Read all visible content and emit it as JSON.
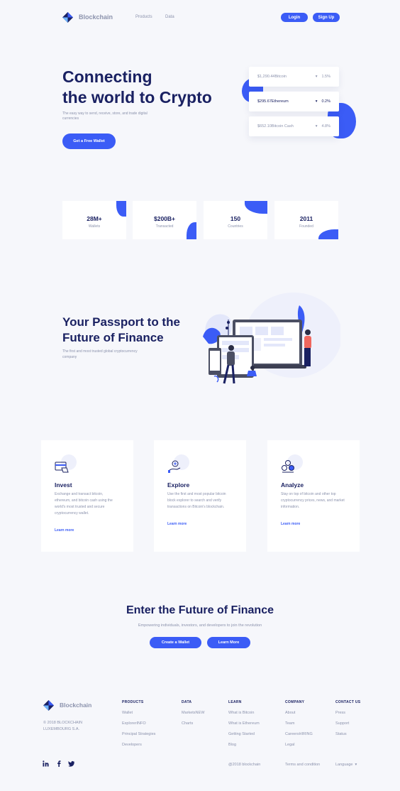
{
  "brand": {
    "name": "Blockchain",
    "accent": "#3b5cf6",
    "navy": "#1a2162",
    "muted": "#8c93ad"
  },
  "nav": {
    "links": [
      "Products",
      "Data"
    ],
    "login": "Login",
    "signup": "Sign Up"
  },
  "hero": {
    "title_line1": "Connecting",
    "title_line2": "the world to Crypto",
    "subtitle": "The easy way to send, receive, store, and trade digital currencies",
    "cta": "Get a Free Wallet",
    "prices": [
      {
        "price": "$1,290.44",
        "coin": "Bitcoin",
        "change": "1.5%"
      },
      {
        "price": "$295.67",
        "coin": "Ethereum",
        "change": "0.2%"
      },
      {
        "price": "$652.10",
        "coin": "Bitcoin Cash",
        "change": "4.8%"
      }
    ]
  },
  "stats": [
    {
      "value": "28M+",
      "label": "Wallets"
    },
    {
      "value": "$200B+",
      "label": "Transacted"
    },
    {
      "value": "150",
      "label": "Countries"
    },
    {
      "value": "2011",
      "label": "Founded"
    }
  ],
  "passport": {
    "title_line1": "Your Passport to the",
    "title_line2": "Future of Finance",
    "subtitle": "The first and most trusted global cryptocurrency company"
  },
  "features": [
    {
      "icon": "wallet-card-icon",
      "title": "Invest",
      "text": "Exchange and transact bitcoin, ethereum, and bitcoin cash using the world's most trusted and secure cryptocurrency wallet.",
      "link": "Learn more"
    },
    {
      "icon": "explore-hand-icon",
      "title": "Explore",
      "text": "Use the first and most popular bitcoin block explorer to search and verify transactions on Bitcoin's blockchain.",
      "link": "Learn more"
    },
    {
      "icon": "analyze-coins-icon",
      "title": "Analyze",
      "text": "Stay on top of bitcoin and other top cryptocurrency prices, news, and market information.",
      "link": "Learn more"
    }
  ],
  "enter": {
    "title": "Enter the Future of Finance",
    "subtitle": "Empowering individuals, investors, and developers to join the revolution",
    "create": "Create a Wallet",
    "learn": "Learn More"
  },
  "footer": {
    "brand": "Blockchain",
    "copyright": "© 2018 BLOCKCHAIN LUXEMBOURG S.A.",
    "columns": [
      {
        "heading": "PRODUCTS",
        "items": [
          "Wallet",
          "ExplorerINFO",
          "Principal Strategies",
          "Developers"
        ]
      },
      {
        "heading": "DATA",
        "items": [
          "MarketsNEW",
          "Charts"
        ]
      },
      {
        "heading": "LEARN",
        "items": [
          "What is Bitcoin",
          "What is Ethereum",
          "Getting Started",
          "Blog"
        ]
      },
      {
        "heading": "COMPANY",
        "items": [
          "About",
          "Team",
          "CareersHIRING",
          "Legal"
        ]
      },
      {
        "heading": "CONTACT US",
        "items": [
          "Press",
          "Support",
          "Status"
        ]
      }
    ],
    "bottom_copy": "@2018 blockchain",
    "terms": "Terms and condition",
    "language": "Language"
  }
}
